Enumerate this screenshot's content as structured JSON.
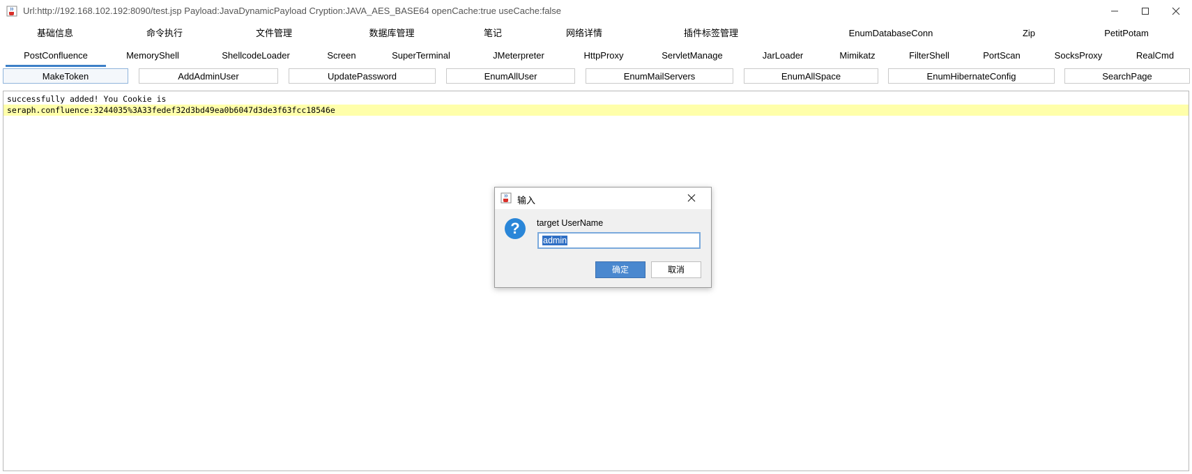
{
  "window": {
    "title": "Url:http://192.168.102.192:8090/test.jsp Payload:JavaDynamicPayload Cryption:JAVA_AES_BASE64 openCache:true useCache:false",
    "icon": "java-cup-icon",
    "controls": [
      "minimize-icon",
      "maximize-icon",
      "close-icon"
    ]
  },
  "tabs_row1": [
    "基础信息",
    "命令执行",
    "文件管理",
    "数据库管理",
    "笔记",
    "网络详情",
    "插件标签管理",
    "EnumDatabaseConn",
    "Zip",
    "PetitPotam"
  ],
  "tabs_row2": [
    "PostConfluence",
    "MemoryShell",
    "ShellcodeLoader",
    "Screen",
    "SuperTerminal",
    "JMeterpreter",
    "HttpProxy",
    "ServletManage",
    "JarLoader",
    "Mimikatz",
    "FilterShell",
    "PortScan",
    "SocksProxy",
    "RealCmd"
  ],
  "selected_tab": "PostConfluence",
  "actions": [
    "MakeToken",
    "AddAdminUser",
    "UpdatePassword",
    "EnumAllUser",
    "EnumMailServers",
    "EnumAllSpace",
    "EnumHibernateConfig",
    "SearchPage"
  ],
  "output": {
    "line1": "successfully added! You Cookie is",
    "line2": "seraph.confluence:3244035%3A33fedef32d3bd49ea0b6047d3de3f63fcc18546e"
  },
  "dialog": {
    "title": "输入",
    "prompt": "target UserName",
    "input_value": "admin",
    "ok_label": "确定",
    "cancel_label": "取消",
    "icon": "question-icon"
  },
  "colors": {
    "accent": "#3c7fc7",
    "highlight": "#ffffaa",
    "ok_button": "#4a88cf"
  }
}
